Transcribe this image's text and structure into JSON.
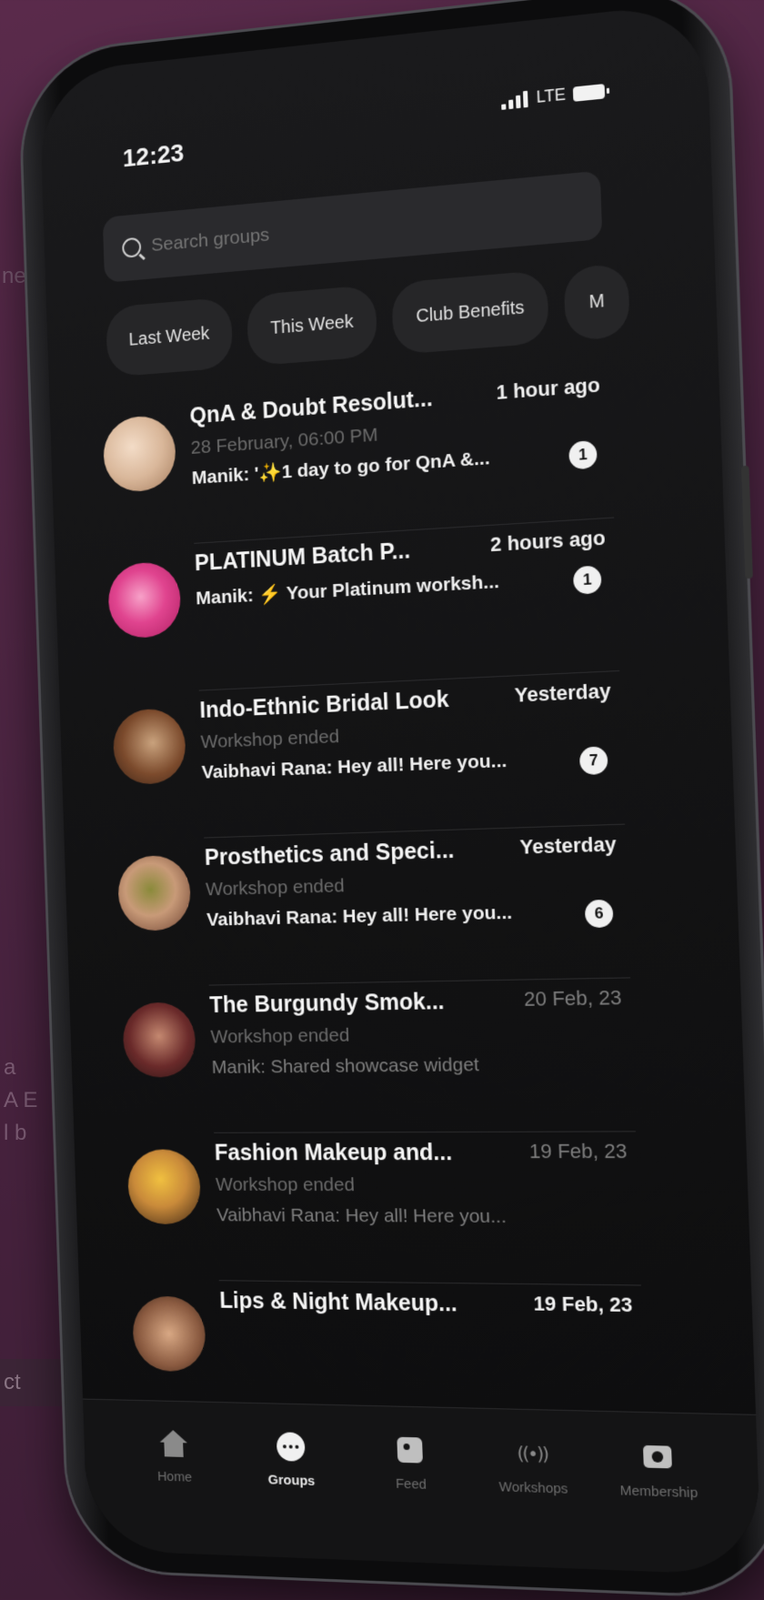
{
  "background_fragments": [
    "ne",
    "a",
    "A E",
    "l b",
    "ct"
  ],
  "status_bar": {
    "time": "12:23",
    "network": "LTE"
  },
  "search": {
    "placeholder": "Search groups"
  },
  "filter_chips": [
    "Last Week",
    "This Week",
    "Club Benefits",
    "M"
  ],
  "groups": [
    {
      "title": "QnA & Doubt Resolut...",
      "time": "1 hour ago",
      "subtitle": "28 February, 06:00 PM",
      "preview": "Manik: '✨1 day to go for QnA &...",
      "unread": "1",
      "avatar_icon": "makeup-tools-avatar"
    },
    {
      "title": "PLATINUM Batch P...",
      "time": "2 hours ago",
      "subtitle": "",
      "preview": "Manik: ⚡ Your Platinum worksh...",
      "unread": "1",
      "avatar_icon": "lipstick-avatar"
    },
    {
      "title": "Indo-Ethnic Bridal Look",
      "time": "Yesterday",
      "subtitle": "Workshop ended",
      "preview": "Vaibhavi Rana: Hey all! Here you...",
      "unread": "7",
      "avatar_icon": "bridal-look-avatar"
    },
    {
      "title": "Prosthetics and Speci...",
      "time": "Yesterday",
      "subtitle": "Workshop ended",
      "preview": "Vaibhavi Rana: Hey all! Here you...",
      "unread": "6",
      "avatar_icon": "prosthetics-avatar"
    },
    {
      "title": "The Burgundy Smok...",
      "time": "20 Feb, 23",
      "subtitle": "Workshop ended",
      "preview": "Manik: Shared showcase widget",
      "unread": "",
      "avatar_icon": "burgundy-avatar"
    },
    {
      "title": "Fashion Makeup and...",
      "time": "19 Feb, 23",
      "subtitle": "Workshop ended",
      "preview": "Vaibhavi Rana: Hey all! Here you...",
      "unread": "",
      "avatar_icon": "fashion-avatar"
    },
    {
      "title": "Lips & Night Makeup...",
      "time": "19 Feb, 23",
      "subtitle": "",
      "preview": "",
      "unread": "",
      "avatar_icon": "lips-avatar"
    }
  ],
  "tab_bar": {
    "active": "Groups",
    "tabs": [
      {
        "label": "Home",
        "icon": "home-icon"
      },
      {
        "label": "Groups",
        "icon": "chat-icon"
      },
      {
        "label": "Feed",
        "icon": "feed-icon"
      },
      {
        "label": "Workshops",
        "icon": "broadcast-icon"
      },
      {
        "label": "Membership",
        "icon": "camera-icon"
      }
    ]
  },
  "colors": {
    "background": "#4a2340",
    "screen": "#121213",
    "text_primary": "#f5f5f5",
    "text_dim": "#6b6b6b"
  }
}
